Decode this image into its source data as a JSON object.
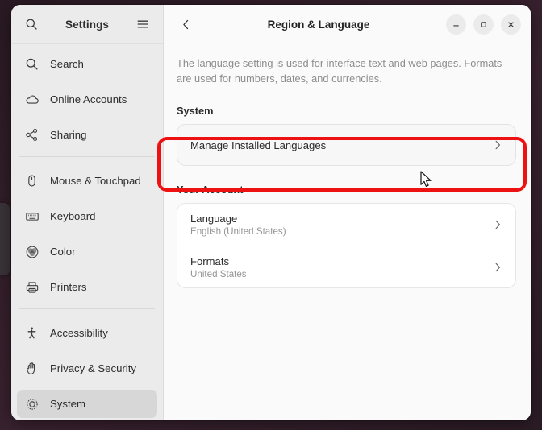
{
  "window": {
    "app_title": "Settings",
    "page_title": "Region & Language",
    "controls": {
      "back": "back-icon",
      "minimize": "minimize-icon",
      "maximize": "maximize-icon",
      "close": "close-icon"
    }
  },
  "sidebar": {
    "search_icon": "search-icon",
    "menu_icon": "hamburger-menu-icon",
    "groups": [
      {
        "items": [
          {
            "label": "Search",
            "icon": "search-icon",
            "selected": false
          },
          {
            "label": "Online Accounts",
            "icon": "cloud-icon",
            "selected": false
          },
          {
            "label": "Sharing",
            "icon": "share-nodes-icon",
            "selected": false
          }
        ]
      },
      {
        "items": [
          {
            "label": "Mouse & Touchpad",
            "icon": "mouse-icon",
            "selected": false
          },
          {
            "label": "Keyboard",
            "icon": "keyboard-icon",
            "selected": false
          },
          {
            "label": "Color",
            "icon": "color-wheel-icon",
            "selected": false
          },
          {
            "label": "Printers",
            "icon": "printer-icon",
            "selected": false
          }
        ]
      },
      {
        "items": [
          {
            "label": "Accessibility",
            "icon": "accessibility-person-icon",
            "selected": false
          },
          {
            "label": "Privacy & Security",
            "icon": "hand-icon",
            "selected": false
          },
          {
            "label": "System",
            "icon": "gear-icon",
            "selected": true
          }
        ]
      }
    ]
  },
  "main": {
    "description": "The language setting is used for interface text and web pages. Formats are used for numbers, dates, and currencies.",
    "system_section": {
      "title": "System",
      "rows": [
        {
          "title": "Manage Installed Languages",
          "subtitle": "",
          "chevron": "chevron-right-icon"
        }
      ]
    },
    "account_section": {
      "title": "Your Account",
      "rows": [
        {
          "title": "Language",
          "subtitle": "English (United States)",
          "chevron": "chevron-right-icon"
        },
        {
          "title": "Formats",
          "subtitle": "United States",
          "chevron": "chevron-right-icon"
        }
      ]
    }
  },
  "annotation": {
    "highlight_color": "#ee1111",
    "highlight_target": "Manage Installed Languages",
    "cursor": "mouse-pointer"
  }
}
